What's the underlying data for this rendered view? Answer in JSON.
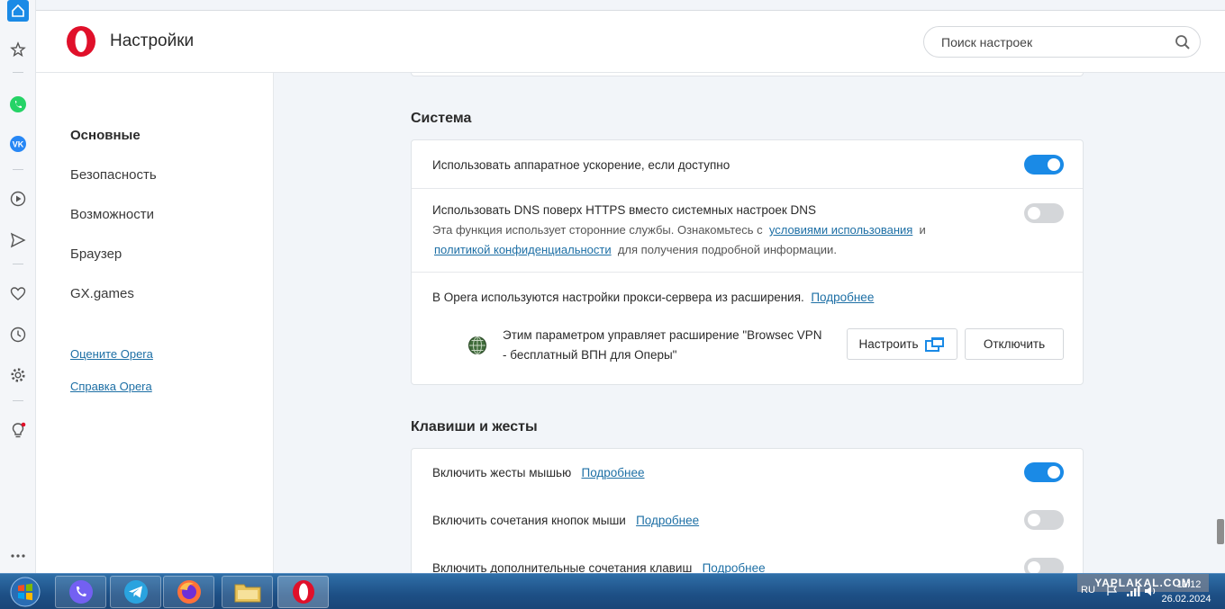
{
  "header": {
    "title": "Настройки",
    "search_placeholder": "Поиск настроек"
  },
  "nav": {
    "items": [
      {
        "label": "Основные",
        "active": true
      },
      {
        "label": "Безопасность",
        "active": false
      },
      {
        "label": "Возможности",
        "active": false
      },
      {
        "label": "Браузер",
        "active": false
      },
      {
        "label": "GX.games",
        "active": false
      }
    ],
    "links": [
      {
        "label": "Оцените Opera"
      },
      {
        "label": "Справка Opera"
      }
    ]
  },
  "system": {
    "title": "Система",
    "hw_accel": {
      "label": "Использовать аппаратное ускорение, если доступно",
      "enabled": true
    },
    "dns": {
      "label": "Использовать DNS поверх HTTPS вместо системных настроек DNS",
      "enabled": false,
      "desc_prefix": "Эта функция использует сторонние службы. Ознакомьтесь с",
      "terms_link": "условиями использования",
      "and": "и",
      "privacy_link": "политикой конфиденциальности",
      "desc_suffix": "для получения подробной информации."
    },
    "proxy": {
      "text": "В Opera используются настройки прокси-сервера из расширения.",
      "more_link": "Подробнее",
      "extension_line1": "Этим параметром управляет расширение \"Browsec VPN",
      "extension_line2": "- бесплатный ВПН для Оперы\"",
      "configure_button": "Настроить",
      "disable_button": "Отключить"
    }
  },
  "shortcuts": {
    "title": "Клавиши и жесты",
    "rows": [
      {
        "label": "Включить жесты мышью",
        "link": "Подробнее",
        "enabled": true
      },
      {
        "label": "Включить сочетания кнопок мыши",
        "link": "Подробнее",
        "enabled": false
      },
      {
        "label": "Включить дополнительные сочетания клавиш",
        "link": "Подробнее",
        "enabled": false
      }
    ]
  },
  "taskbar": {
    "lang": "RU",
    "time": "11:12",
    "date": "26.02.2024",
    "watermark": "YAPLAKAL.COM"
  },
  "colors": {
    "accent": "#1a8ae6",
    "opera_red": "#e0102a",
    "link": "#1d6fa5"
  }
}
